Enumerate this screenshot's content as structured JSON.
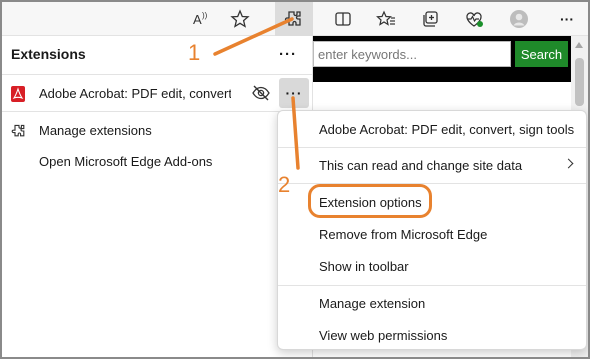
{
  "toolbar": {
    "icons": [
      "read-aloud-icon",
      "favorite-star-icon",
      "extensions-icon",
      "split-screen-icon",
      "favorites-icon",
      "collections-icon",
      "performance-heart-icon",
      "profile-icon",
      "more-icon"
    ],
    "more_label": "···"
  },
  "page": {
    "search_placeholder": "enter keywords...",
    "search_button": "Search"
  },
  "extensions_panel": {
    "title": "Extensions",
    "more_label": "···",
    "extension_name": "Adobe Acrobat: PDF edit, convert,...",
    "row_more_label": "···",
    "manage_label": "Manage extensions",
    "addons_label": "Open Microsoft Edge Add-ons"
  },
  "context_menu": {
    "items": [
      {
        "label": "Adobe Acrobat: PDF edit, convert, sign tools"
      },
      {
        "label": "This can read and change site data"
      },
      {
        "label": "Extension options"
      },
      {
        "label": "Remove from Microsoft Edge"
      },
      {
        "label": "Show in toolbar"
      },
      {
        "label": "Manage extension"
      },
      {
        "label": "View web permissions"
      }
    ]
  },
  "annotations": {
    "step1": "1",
    "step2": "2",
    "color": "#e8822f"
  }
}
